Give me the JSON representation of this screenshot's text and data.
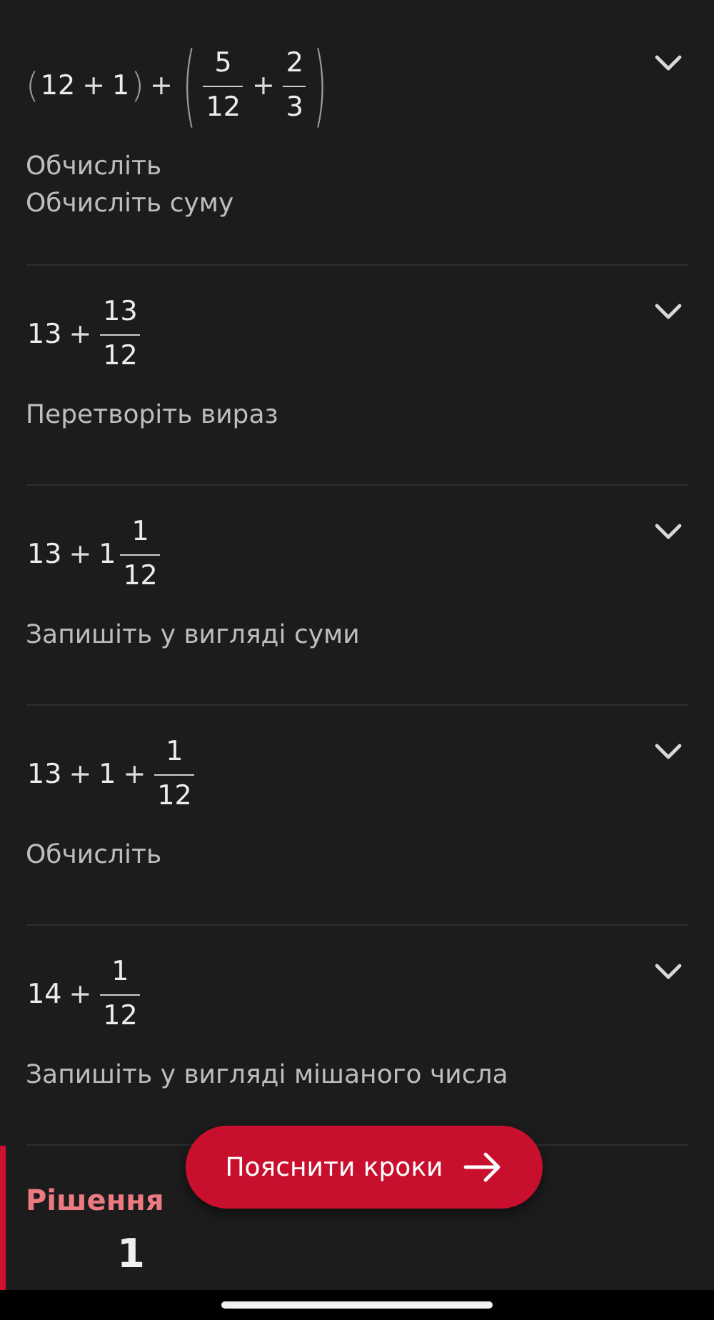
{
  "steps": [
    {
      "expanded": false,
      "expression": [
        {
          "kind": "group",
          "open": "(",
          "close": ")",
          "items": [
            {
              "kind": "num",
              "text": "12"
            },
            {
              "kind": "op",
              "text": "+"
            },
            {
              "kind": "num",
              "text": "1"
            }
          ]
        },
        {
          "kind": "op",
          "text": "+"
        },
        {
          "kind": "group",
          "open": "(",
          "close": ")",
          "items": [
            {
              "kind": "frac",
              "num": "5",
              "den": "12"
            },
            {
              "kind": "op",
              "text": "+"
            },
            {
              "kind": "frac",
              "num": "2",
              "den": "3"
            }
          ]
        }
      ],
      "captions": [
        "Обчисліть",
        "Обчисліть суму"
      ]
    },
    {
      "expanded": false,
      "expression": [
        {
          "kind": "num",
          "text": "13"
        },
        {
          "kind": "op",
          "text": "+"
        },
        {
          "kind": "frac",
          "num": "13",
          "den": "12"
        }
      ],
      "captions": [
        "Перетворіть вираз"
      ]
    },
    {
      "expanded": false,
      "expression": [
        {
          "kind": "num",
          "text": "13"
        },
        {
          "kind": "op",
          "text": "+"
        },
        {
          "kind": "mixed",
          "whole": "1",
          "num": "1",
          "den": "12"
        }
      ],
      "captions": [
        "Запишіть у вигляді суми"
      ]
    },
    {
      "expanded": false,
      "expression": [
        {
          "kind": "num",
          "text": "13"
        },
        {
          "kind": "op",
          "text": "+"
        },
        {
          "kind": "num",
          "text": "1"
        },
        {
          "kind": "op",
          "text": "+"
        },
        {
          "kind": "frac",
          "num": "1",
          "den": "12"
        }
      ],
      "captions": [
        "Обчисліть"
      ]
    },
    {
      "expanded": false,
      "expression": [
        {
          "kind": "num",
          "text": "14"
        },
        {
          "kind": "op",
          "text": "+"
        },
        {
          "kind": "frac",
          "num": "1",
          "den": "12"
        }
      ],
      "captions": [
        "Запишіть у вигляді мішаного числа"
      ]
    }
  ],
  "solution": {
    "title": "Рішення",
    "value": "1"
  },
  "explain_button": {
    "label": "Пояснити кроки"
  }
}
